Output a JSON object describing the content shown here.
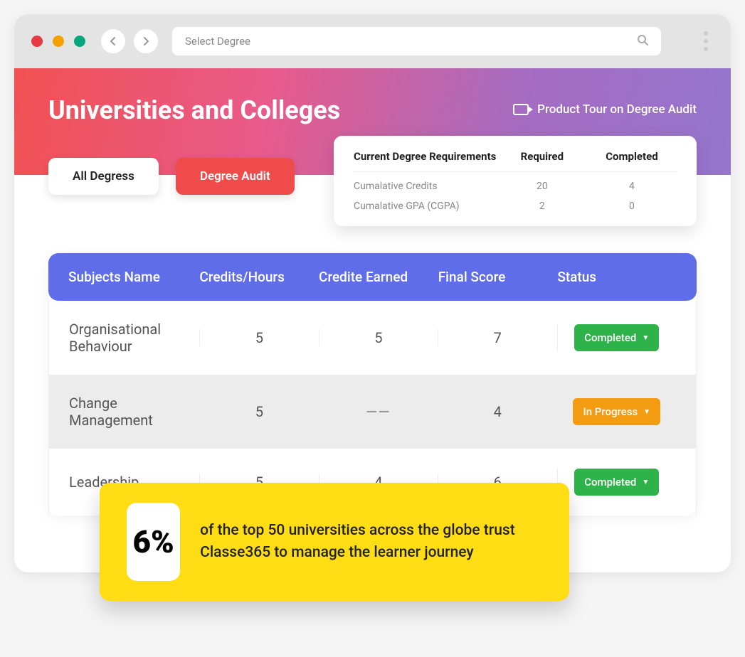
{
  "browser": {
    "search_placeholder": "Select Degree"
  },
  "hero": {
    "title": "Universities and Colleges",
    "product_tour": "Product Tour on Degree Audit"
  },
  "tabs": {
    "all_degrees": "All Degress",
    "degree_audit": "Degree Audit"
  },
  "requirements": {
    "header_title": "Current Degree Requirements",
    "header_required": "Required",
    "header_completed": "Completed",
    "rows": [
      {
        "label": "Cumalative Credits",
        "required": "20",
        "completed": "4"
      },
      {
        "label": "Cumalative GPA (CGPA)",
        "required": "2",
        "completed": "0"
      }
    ]
  },
  "table": {
    "headers": {
      "subject": "Subjects Name",
      "credits": "Credits/Hours",
      "earned": "Credite Earned",
      "score": "Final Score",
      "status": "Status"
    },
    "rows": [
      {
        "subject": "Organisational Behaviour",
        "credits": "5",
        "earned": "5",
        "score": "7",
        "status": "Completed",
        "status_class": "green"
      },
      {
        "subject": "Change Management",
        "credits": "5",
        "earned": "——",
        "score": "4",
        "status": "In Progress",
        "status_class": "orange"
      },
      {
        "subject": "Leadership",
        "credits": "5",
        "earned": "4",
        "score": "6",
        "status": "Completed",
        "status_class": "green"
      }
    ]
  },
  "callout": {
    "percent": "6%",
    "text": "of the top 50 universities across the globe trust Classe365 to manage the learner journey"
  }
}
